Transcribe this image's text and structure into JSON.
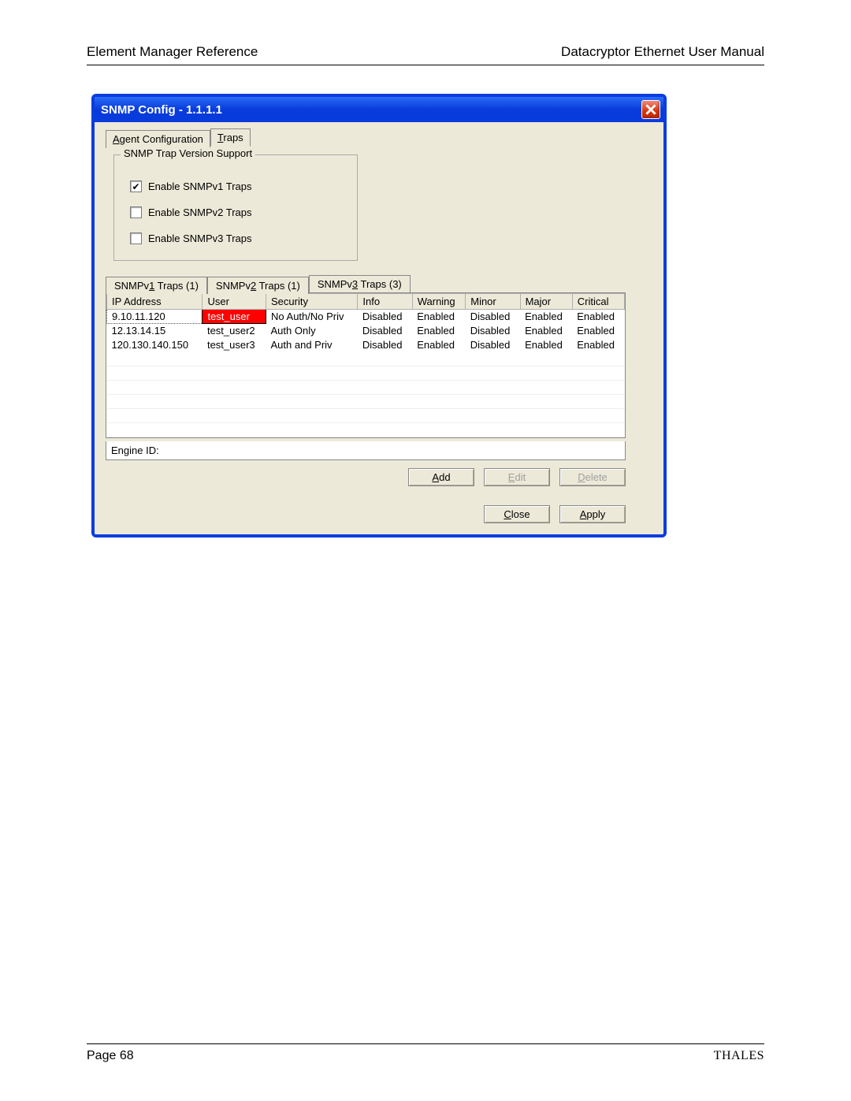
{
  "doc": {
    "header_left": "Element Manager Reference",
    "header_right": "Datacryptor Ethernet User Manual",
    "footer_left": "Page 68",
    "footer_right": "THALES"
  },
  "window": {
    "title": "SNMP Config - 1.1.1.1"
  },
  "top_tabs": {
    "agent_prefix": "A",
    "agent_rest": "gent Configuration",
    "traps_prefix": "T",
    "traps_rest": "raps"
  },
  "group": {
    "legend": "SNMP Trap Version Support",
    "v1": "Enable SNMPv1 Traps",
    "v2": "Enable SNMPv2 Traps",
    "v3": "Enable SNMPv3 Traps",
    "v1_checked": true,
    "v2_checked": false,
    "v3_checked": false
  },
  "sub_tabs": {
    "t1_a": "SNMPv",
    "t1_u": "1",
    "t1_b": " Traps (1)",
    "t2_a": "SNMPv",
    "t2_u": "2",
    "t2_b": " Traps (1)",
    "t3_a": "SNMPv",
    "t3_u": "3",
    "t3_b": " Traps (3)"
  },
  "columns": {
    "ip": "IP Address",
    "user": "User",
    "security": "Security",
    "info": "Info",
    "warning": "Warning",
    "minor": "Minor",
    "major": "Major",
    "critical": "Critical"
  },
  "rows": [
    {
      "ip": "9.10.11.120",
      "user": "test_user",
      "security": "No Auth/No Priv",
      "info": "Disabled",
      "warning": "Enabled",
      "minor": "Disabled",
      "major": "Enabled",
      "critical": "Enabled",
      "highlight": true
    },
    {
      "ip": "12.13.14.15",
      "user": "test_user2",
      "security": "Auth Only",
      "info": "Disabled",
      "warning": "Enabled",
      "minor": "Disabled",
      "major": "Enabled",
      "critical": "Enabled",
      "highlight": false
    },
    {
      "ip": "120.130.140.150",
      "user": "test_user3",
      "security": "Auth and Priv",
      "info": "Disabled",
      "warning": "Enabled",
      "minor": "Disabled",
      "major": "Enabled",
      "critical": "Enabled",
      "highlight": false
    }
  ],
  "engine_label": "Engine ID:",
  "buttons": {
    "add_u": "A",
    "add_r": "dd",
    "edit_u": "E",
    "edit_r": "dit",
    "delete_u": "D",
    "delete_r": "elete",
    "close_u": "C",
    "close_r": "lose",
    "apply_u": "A",
    "apply_r": "pply"
  }
}
